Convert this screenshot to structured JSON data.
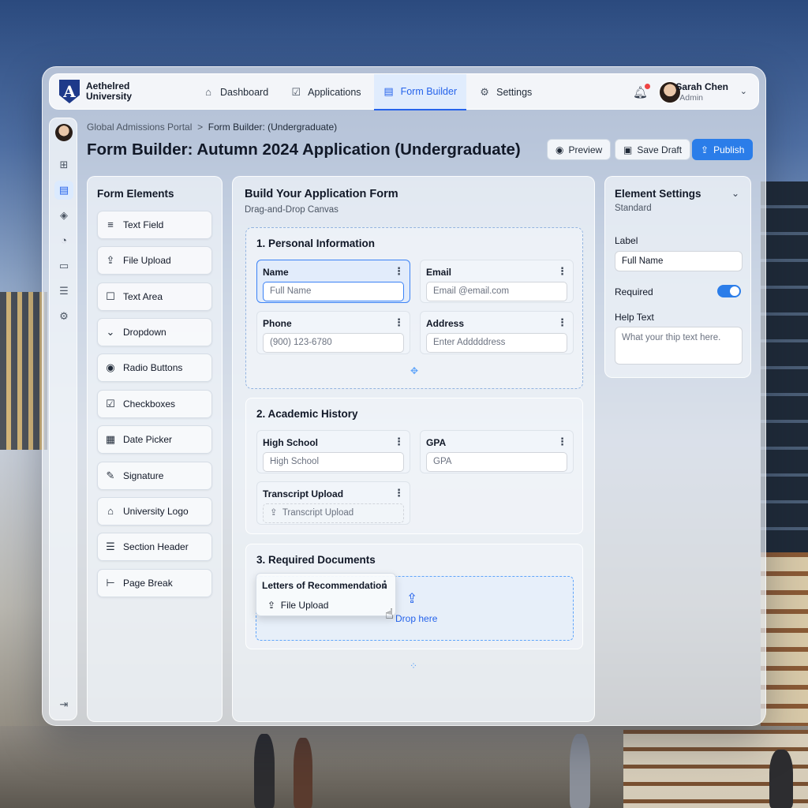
{
  "brand": {
    "line1": "Aethelred",
    "line2": "University",
    "logo_letter": "A",
    "logo_icon": "shield-logo-icon"
  },
  "nav": {
    "items": [
      {
        "label": "Dashboard",
        "icon": "home-icon"
      },
      {
        "label": "Applications",
        "icon": "checklist-icon"
      },
      {
        "label": "Form Builder",
        "icon": "document-icon",
        "active": true
      },
      {
        "label": "Settings",
        "icon": "gear-icon"
      }
    ]
  },
  "user": {
    "name": "Sarah Chen",
    "role": "Admin"
  },
  "breadcrumb": {
    "parent": "Global Admissions Portal",
    "separator": ">",
    "current": "Form Builder: (Undergraduate)"
  },
  "page": {
    "title": "Form Builder: Autumn 2024 Application (Undergraduate)"
  },
  "actions": {
    "preview": "Preview",
    "save_draft": "Save Draft",
    "publish": "Publish"
  },
  "elements_panel": {
    "title": "Form Elements",
    "items": [
      {
        "label": "Text Field",
        "icon": "text-lines-icon"
      },
      {
        "label": "File Upload",
        "icon": "upload-icon"
      },
      {
        "label": "Text Area",
        "icon": "text-area-icon"
      },
      {
        "label": "Dropdown",
        "icon": "dropdown-icon"
      },
      {
        "label": "Radio Buttons",
        "icon": "radio-icon"
      },
      {
        "label": "Checkboxes",
        "icon": "checkbox-icon"
      },
      {
        "label": "Date Picker",
        "icon": "calendar-icon"
      },
      {
        "label": "Signature",
        "icon": "pen-icon"
      },
      {
        "label": "University Logo",
        "icon": "institution-icon"
      },
      {
        "label": "Section Header",
        "icon": "heading-icon"
      },
      {
        "label": "Page Break",
        "icon": "page-break-icon"
      }
    ]
  },
  "canvas": {
    "title": "Build Your Application Form",
    "subtitle": "Drag-and-Drop Canvas",
    "sections": [
      {
        "title": "1. Personal Information",
        "fields": [
          {
            "label": "Name",
            "placeholder": "Full Name",
            "selected": true
          },
          {
            "label": "Email",
            "placeholder": "Email @email.com"
          },
          {
            "label": "Phone",
            "placeholder": "(900) 123-6780"
          },
          {
            "label": "Address",
            "placeholder": "Enter Adddddress"
          }
        ]
      },
      {
        "title": "2. Academic History",
        "fields": [
          {
            "label": "High School",
            "placeholder": "High School"
          },
          {
            "label": "GPA",
            "placeholder": "GPA"
          },
          {
            "label": "Transcript Upload",
            "placeholder": "Transcript Upload"
          }
        ]
      },
      {
        "title": "3. Required Documents",
        "drag_card": {
          "label": "Letters of Recommendation",
          "value": "File Upload"
        },
        "drop_text": "Drop here"
      }
    ]
  },
  "settings_panel": {
    "title": "Element Settings",
    "subtitle": "Standard",
    "label_title": "Label",
    "label_value": "Full Name",
    "required_title": "Required",
    "required_on": true,
    "help_title": "Help Text",
    "help_placeholder": "What your thip text here."
  },
  "colors": {
    "accent": "#2b7de9",
    "active_bg": "#dbeafe",
    "brand": "#1e3a8a"
  }
}
